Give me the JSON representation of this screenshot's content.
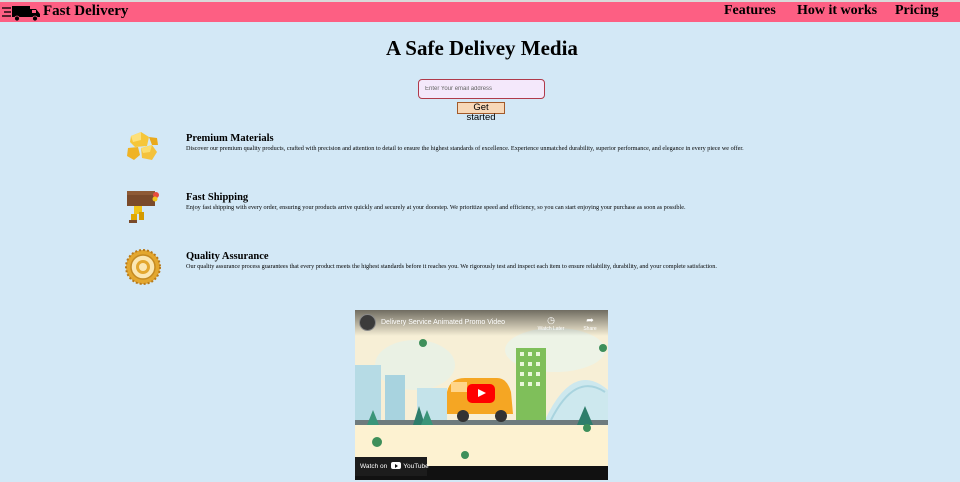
{
  "nav": {
    "brand": "Fast Delivery",
    "logo_icon": "delivery-truck-icon",
    "links": [
      "Features",
      "How it works",
      "Pricing"
    ],
    "bar_color": "#fd5f83"
  },
  "hero": {
    "title": "A Safe Delivey Media",
    "email_placeholder": "Enter Your email address",
    "cta_label": "Get started"
  },
  "features": [
    {
      "icon": "gold-nuggets-icon",
      "title": "Premium Materials",
      "desc": "Discover our premium quality products, crafted with precision and attention to detail to ensure the highest standards of excellence. Experience unmatched durability, superior performance, and elegance in every piece we offer."
    },
    {
      "icon": "delivery-box-icon",
      "title": "Fast Shipping",
      "desc": "Enjoy fast shipping with every order, ensuring your products arrive quickly and securely at your doorstep. We prioritize speed and efficiency, so you can start enjoying your purchase as soon as possible."
    },
    {
      "icon": "quality-seal-icon",
      "title": "Quality Assurance",
      "desc": "Our quality assurance process guarantees that every product meets the highest standards before it reaches you. We rigorously test and inspect each item to ensure reliability, durability, and your complete satisfaction."
    }
  ],
  "video": {
    "title": "Delivery Service Animated Promo Video",
    "watch_later": "Watch Later",
    "share": "Share",
    "watch_on": "Watch on",
    "platform": "YouTube",
    "play_icon": "play-icon"
  },
  "colors": {
    "background": "#d3e8f6",
    "input_border": "#b03a4a",
    "button_bg": "#f8d8b8"
  }
}
